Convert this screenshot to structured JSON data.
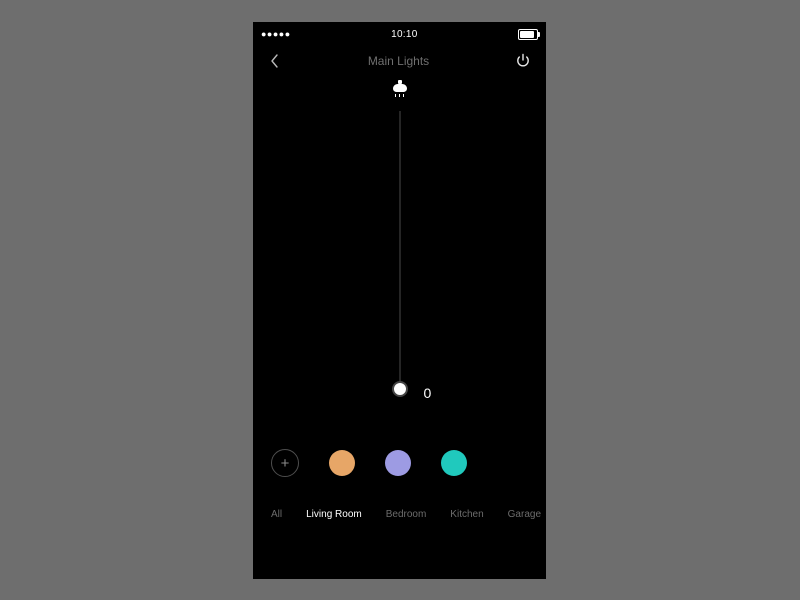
{
  "status": {
    "signal_dots": "●●●●●",
    "time": "10:10"
  },
  "nav": {
    "title": "Main Lights"
  },
  "slider": {
    "value": "0"
  },
  "presets": {
    "add_glyph": "+",
    "colors": [
      "#e7a667",
      "#9d9be3",
      "#20c9bd"
    ]
  },
  "rooms": {
    "items": [
      "All",
      "Living Room",
      "Bedroom",
      "Kitchen",
      "Garage"
    ],
    "active_index": 1
  }
}
